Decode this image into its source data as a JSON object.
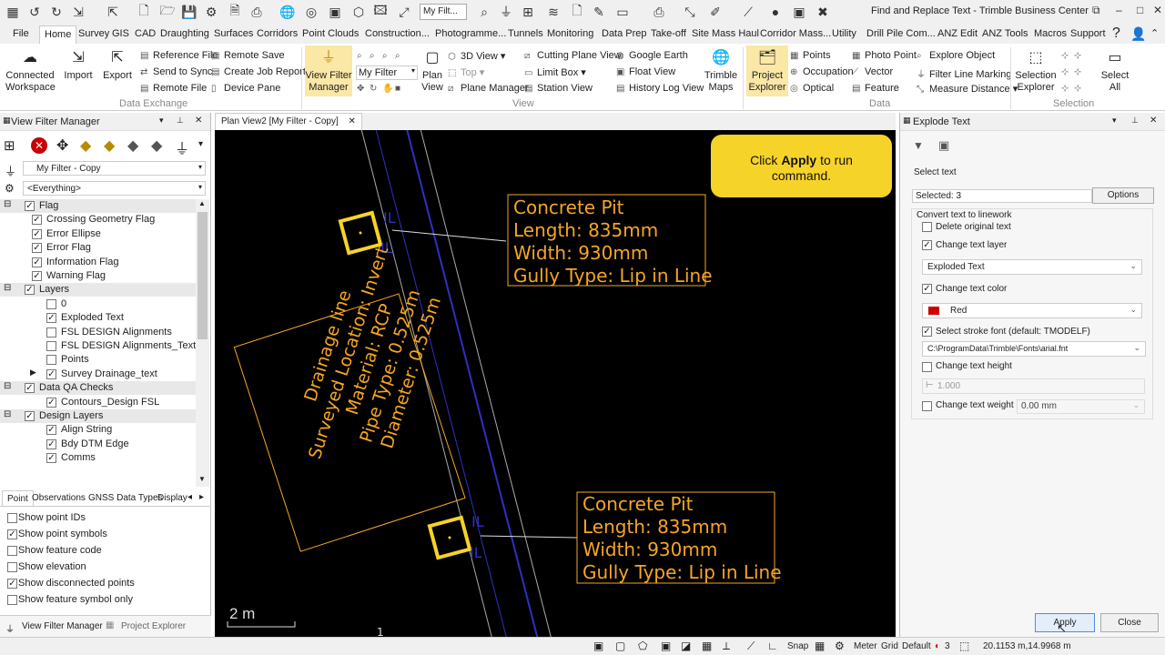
{
  "app": {
    "title": "Find and Replace Text - Trimble Business Center",
    "filter_box": "My Filt..."
  },
  "menu": [
    "File",
    "Home",
    "Survey",
    "GIS",
    "CAD",
    "Draughting",
    "Surfaces",
    "Corridors",
    "Point Clouds",
    "Construction...",
    "Photogramme...",
    "Tunnels",
    "Monitoring",
    "Data Prep",
    "Take-off",
    "Site Mass Haul",
    "Corridor Mass...",
    "Utility",
    "Drill Pile Com...",
    "ANZ Edit",
    "ANZ Tools",
    "Macros",
    "Support"
  ],
  "ribbon": {
    "connected_workspace": "Connected\nWorkspace",
    "import": "Import",
    "export": "Export",
    "reference_file": "Reference File",
    "send_to_sync": "Send to Sync",
    "remote_file": "Remote File",
    "remote_save": "Remote Save",
    "create_job_report": "Create Job Report",
    "device_pane": "Device Pane",
    "data_exchange": "Data Exchange",
    "view_filter_manager": "View Filter\nManager",
    "my_filter": "My Filter",
    "plan_view": "Plan\nView",
    "view_3d": "3D View",
    "top": "Top",
    "plane_manager": "Plane Manager",
    "cutting_plane_view": "Cutting Plane View",
    "limit_box": "Limit Box",
    "station_view": "Station View",
    "google_earth": "Google Earth",
    "float_view": "Float View",
    "history_log_view": "History Log View",
    "trimble_maps": "Trimble\nMaps",
    "view": "View",
    "project_explorer": "Project\nExplorer",
    "points": "Points",
    "occupation": "Occupation",
    "optical": "Optical",
    "photo_point": "Photo Point",
    "vector": "Vector",
    "feature": "Feature",
    "explore_object": "Explore Object",
    "filter_line_marking": "Filter Line Marking",
    "measure_distance": "Measure Distance",
    "data": "Data",
    "selection_explorer": "Selection\nExplorer",
    "select_all": "Select\nAll",
    "selection": "Selection"
  },
  "left": {
    "title": "View Filter Manager",
    "filter": "My Filter - Copy",
    "scope": "<Everything>",
    "tree": [
      {
        "label": "Flag",
        "group": true,
        "checked": true
      },
      {
        "label": "Crossing Geometry Flag",
        "checked": true
      },
      {
        "label": "Error Ellipse",
        "checked": true
      },
      {
        "label": "Error Flag",
        "checked": true
      },
      {
        "label": "Information Flag",
        "checked": true
      },
      {
        "label": "Warning Flag",
        "checked": true
      },
      {
        "label": "Layers",
        "group": true,
        "checked": true
      },
      {
        "label": "0",
        "checked": false,
        "layer": true
      },
      {
        "label": "Exploded Text",
        "checked": true,
        "layer": true
      },
      {
        "label": "FSL DESIGN Alignments",
        "checked": false,
        "layer": true
      },
      {
        "label": "FSL DESIGN Alignments_Text",
        "checked": false,
        "layer": true
      },
      {
        "label": "Points",
        "checked": false,
        "layer": true
      },
      {
        "label": "Survey Drainage_text",
        "checked": true,
        "layer": true,
        "expand": true
      },
      {
        "label": "Data QA Checks",
        "group": true,
        "checked": true
      },
      {
        "label": "Contours_Design FSL",
        "checked": true,
        "layer": true
      },
      {
        "label": "Design Layers",
        "group": true,
        "checked": true
      },
      {
        "label": "Align String",
        "checked": true,
        "layer": true
      },
      {
        "label": "Bdy DTM Edge",
        "checked": true,
        "layer": true
      },
      {
        "label": "Comms",
        "checked": true,
        "layer": true
      }
    ],
    "tabs": [
      "Point",
      "Observations",
      "GNSS Data Types",
      "Display"
    ],
    "options": [
      {
        "label": "Show point IDs",
        "checked": false
      },
      {
        "label": "Show point symbols",
        "checked": true
      },
      {
        "label": "Show feature code",
        "checked": false
      },
      {
        "label": "Show elevation",
        "checked": false
      },
      {
        "label": "Show disconnected points",
        "checked": true
      },
      {
        "label": "Show feature symbol only",
        "checked": false
      }
    ],
    "bottom_tabs": [
      "View Filter Manager",
      "Project Explorer"
    ]
  },
  "plan": {
    "tab": "Plan View2 [My Filter - Copy]",
    "tooltip_pre": "Click ",
    "tooltip_bold": "Apply",
    "tooltip_post": " to run",
    "tooltip_line2": "command.",
    "label1": [
      "Concrete Pit",
      "Length: 835mm",
      "Width: 930mm",
      "Gully Type: Lip in Line"
    ],
    "label2": [
      "Concrete Pit",
      "Length: 835mm",
      "Width: 930mm",
      "Gully Type: Lip in Line"
    ],
    "rotated": [
      "Drainage line",
      "Surveyed Location: Invert",
      "Material: RCP",
      "Pipe Type: 0.525m",
      "Diameter: 0.525m"
    ],
    "scale": "2 m"
  },
  "right": {
    "title": "Explode Text",
    "select_text": "Select text",
    "selected": "Selected: 3",
    "options_btn": "Options",
    "convert": "Convert text to linework",
    "delete_original": "Delete original text",
    "change_layer": "Change text layer",
    "layer_value": "Exploded Text",
    "change_color": "Change text color",
    "color_value": "Red",
    "stroke_font": "Select stroke font (default: TMODELF)",
    "font_path": "C:\\ProgramData\\Trimble\\Fonts\\arial.fnt",
    "change_height": "Change text height",
    "height_value": "1.000",
    "change_weight": "Change text weight",
    "weight_value": "0.00 mm",
    "apply": "Apply",
    "close": "Close"
  },
  "status": {
    "snap": "Snap",
    "meter": "Meter",
    "grid": "Grid",
    "default": "Default",
    "count": "3",
    "coords": "20.1153 m,14.9968 m"
  },
  "colors": {
    "accent": "#f6d328",
    "label_stroke": "#f5a623",
    "text_orange": "#f5a623",
    "plan_bg": "#000000",
    "red": "#cc0000"
  }
}
